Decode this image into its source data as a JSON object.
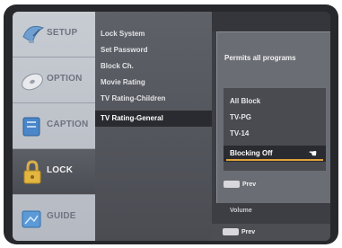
{
  "tabs": [
    {
      "label": "SETUP",
      "icon": "satellite-dish-icon",
      "active": false
    },
    {
      "label": "OPTION",
      "icon": "disc-icon",
      "active": false
    },
    {
      "label": "CAPTION",
      "icon": "caption-icon",
      "active": false
    },
    {
      "label": "LOCK",
      "icon": "padlock-icon",
      "active": true
    },
    {
      "label": "GUIDE",
      "icon": "guide-icon",
      "active": false
    }
  ],
  "menu": {
    "items": [
      "Lock System",
      "Set Password",
      "Block Ch.",
      "Movie Rating",
      "TV Rating-Children",
      "TV Rating-General"
    ],
    "selected_index": 5
  },
  "popup": {
    "title": "Permits all programs",
    "options": [
      "All Block",
      "TV-PG",
      "TV-14",
      "Blocking Off"
    ],
    "selected_index": 3,
    "prev_button": "Prev"
  },
  "footer": {
    "volume_label": "Volume",
    "prev_button": "Prev"
  },
  "colors": {
    "active_tab": "#4b4d54",
    "highlight_underline": "#e1a33a",
    "menu_bg": "#55575e"
  }
}
